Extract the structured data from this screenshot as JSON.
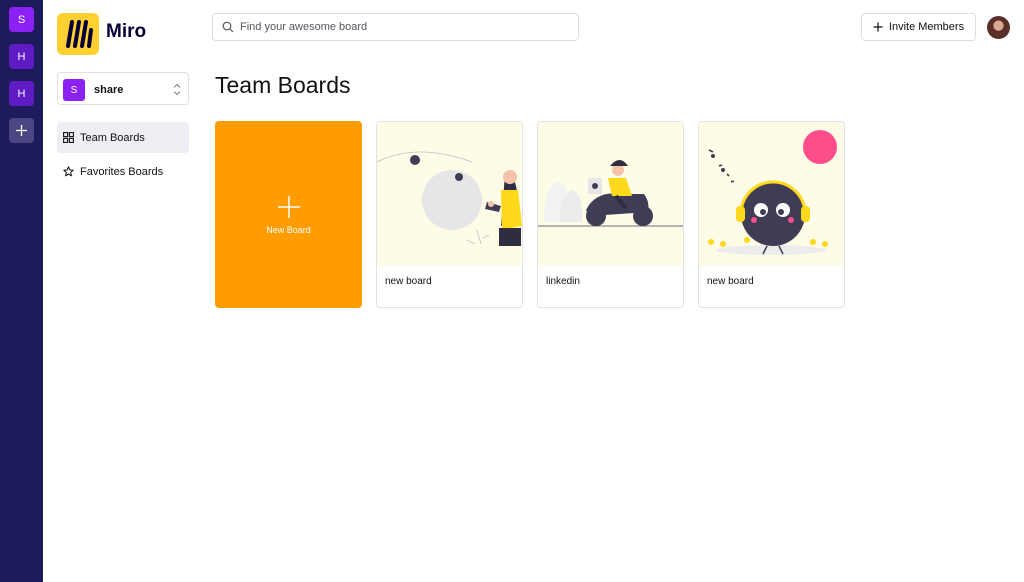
{
  "rail": {
    "orgs": [
      {
        "initial": "S"
      },
      {
        "initial": "H"
      },
      {
        "initial": "H"
      }
    ]
  },
  "brand": {
    "name": "Miro"
  },
  "workspace": {
    "initial": "S",
    "name": "share"
  },
  "nav": {
    "items": [
      {
        "label": "Team Boards",
        "icon": "grid-icon"
      },
      {
        "label": "Favorites Boards",
        "icon": "star-icon"
      }
    ]
  },
  "search": {
    "placeholder": "Find your awesome board",
    "value": ""
  },
  "header": {
    "invite_label": "Invite Members"
  },
  "main": {
    "title": "Team Boards",
    "new_board_label": "New Board",
    "boards": [
      {
        "title": "new board"
      },
      {
        "title": "linkedin"
      },
      {
        "title": "new board"
      }
    ]
  },
  "colors": {
    "rail": "#1e1b5c",
    "accent_purple": "#8b21f2",
    "new_board_orange": "#ff9d00",
    "logo_yellow": "#ffd02f"
  }
}
